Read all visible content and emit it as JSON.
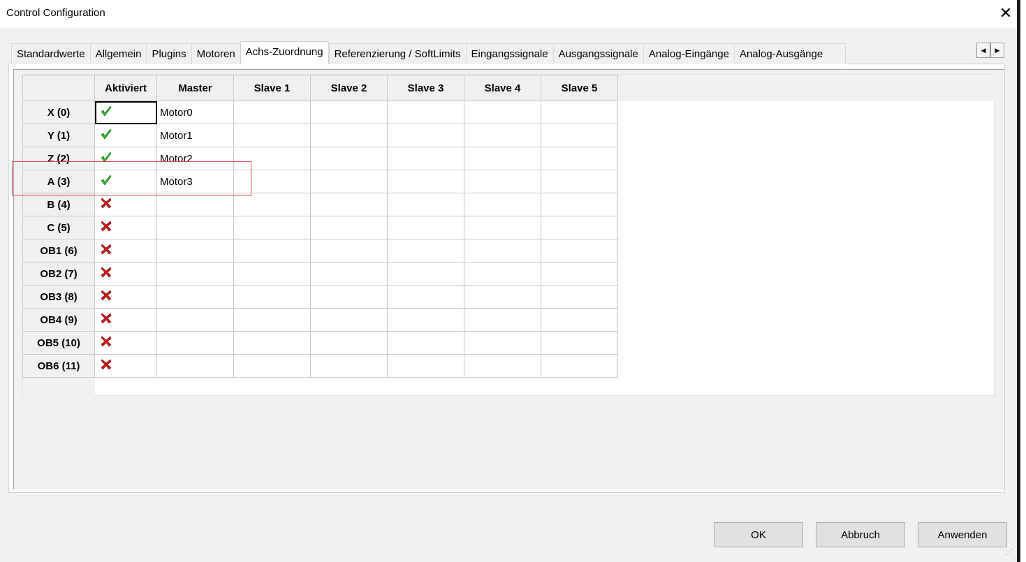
{
  "window": {
    "title": "Control Configuration",
    "close_glyph": "✕"
  },
  "tabs": [
    {
      "label": "Standardwerte",
      "active": false
    },
    {
      "label": "Allgemein",
      "active": false
    },
    {
      "label": "Plugins",
      "active": false
    },
    {
      "label": "Motoren",
      "active": false
    },
    {
      "label": "Achs-Zuordnung",
      "active": true
    },
    {
      "label": "Referenzierung / SoftLimits",
      "active": false
    },
    {
      "label": "Eingangssignale",
      "active": false
    },
    {
      "label": "Ausgangssignale",
      "active": false
    },
    {
      "label": "Analog-Eingänge",
      "active": false
    },
    {
      "label": "Analog-Ausgänge",
      "active": false
    }
  ],
  "tab_scroll": {
    "left_glyph": "◀",
    "right_glyph": "▶"
  },
  "grid": {
    "columns": [
      "Aktiviert",
      "Master",
      "Slave 1",
      "Slave 2",
      "Slave 3",
      "Slave 4",
      "Slave 5"
    ],
    "rows": [
      {
        "axis": "X (0)",
        "enabled": true,
        "master": "Motor0",
        "slaves": [
          "",
          "",
          "",
          "",
          ""
        ]
      },
      {
        "axis": "Y (1)",
        "enabled": true,
        "master": "Motor1",
        "slaves": [
          "",
          "",
          "",
          "",
          ""
        ]
      },
      {
        "axis": "Z (2)",
        "enabled": true,
        "master": "Motor2",
        "slaves": [
          "",
          "",
          "",
          "",
          ""
        ]
      },
      {
        "axis": "A (3)",
        "enabled": true,
        "master": "Motor3",
        "slaves": [
          "",
          "",
          "",
          "",
          ""
        ]
      },
      {
        "axis": "B (4)",
        "enabled": false,
        "master": "",
        "slaves": [
          "",
          "",
          "",
          "",
          ""
        ]
      },
      {
        "axis": "C (5)",
        "enabled": false,
        "master": "",
        "slaves": [
          "",
          "",
          "",
          "",
          ""
        ]
      },
      {
        "axis": "OB1 (6)",
        "enabled": false,
        "master": "",
        "slaves": [
          "",
          "",
          "",
          "",
          ""
        ]
      },
      {
        "axis": "OB2 (7)",
        "enabled": false,
        "master": "",
        "slaves": [
          "",
          "",
          "",
          "",
          ""
        ]
      },
      {
        "axis": "OB3 (8)",
        "enabled": false,
        "master": "",
        "slaves": [
          "",
          "",
          "",
          "",
          ""
        ]
      },
      {
        "axis": "OB4 (9)",
        "enabled": false,
        "master": "",
        "slaves": [
          "",
          "",
          "",
          "",
          ""
        ]
      },
      {
        "axis": "OB5 (10)",
        "enabled": false,
        "master": "",
        "slaves": [
          "",
          "",
          "",
          "",
          ""
        ]
      },
      {
        "axis": "OB6 (11)",
        "enabled": false,
        "master": "",
        "slaves": [
          "",
          "",
          "",
          "",
          ""
        ]
      }
    ],
    "enabled_icon": "green-checkmark-icon",
    "disabled_icon": "red-x-icon",
    "enabled_color": "#2db82d",
    "disabled_color": "#d11a1a"
  },
  "buttons": {
    "ok": "OK",
    "cancel": "Abbruch",
    "apply": "Anwenden"
  }
}
